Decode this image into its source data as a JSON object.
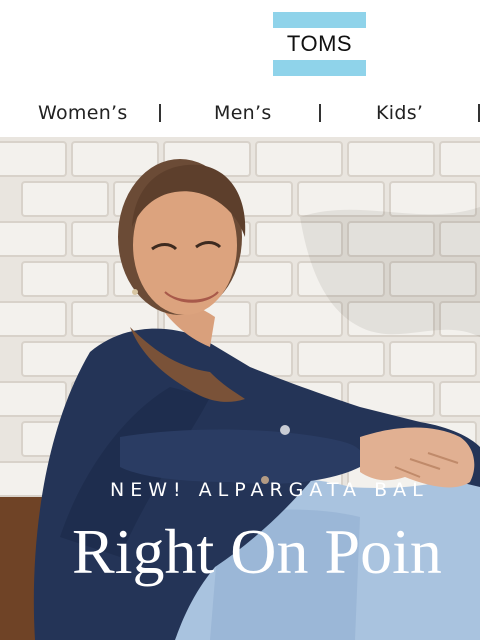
{
  "brand": {
    "logo_text": "TOMS",
    "logo_color": "#8fd3ea"
  },
  "nav": {
    "items": [
      {
        "label": "Women’s"
      },
      {
        "label": "Men’s"
      },
      {
        "label": "Kids’"
      }
    ]
  },
  "hero": {
    "kicker": "NEW! ALPARGATA BAL",
    "headline": "Right On Poin"
  }
}
